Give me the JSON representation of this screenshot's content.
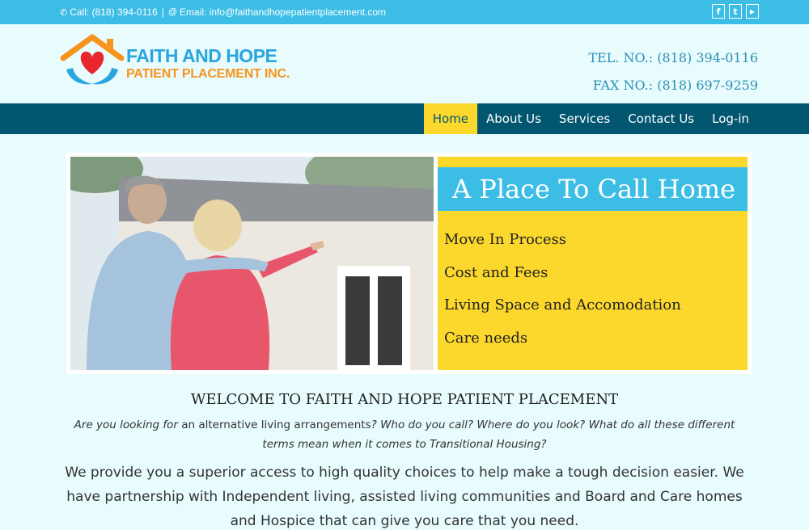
{
  "topbar": {
    "call_label": "Call: (818) 394-0116",
    "separator": "|",
    "email_label": "Email: info@faithandhopepatientplacement.com",
    "social": [
      {
        "icon": "facebook-icon",
        "glyph": "f"
      },
      {
        "icon": "twitter-icon",
        "glyph": "t"
      },
      {
        "icon": "youtube-icon",
        "glyph": "▶"
      }
    ]
  },
  "header": {
    "logo_line1": "FAITH AND HOPE",
    "logo_line2": "PATIENT PLACEMENT INC.",
    "tel": "TEL. NO.: (818) 394-0116",
    "fax": "FAX NO.: (818) 697-9259"
  },
  "nav": {
    "items": [
      "Home",
      "About Us",
      "Services",
      "Contact Us",
      "Log-in"
    ],
    "active": "Home"
  },
  "hero": {
    "title": "A Place To Call Home",
    "links": [
      "Move In Process",
      "Cost and Fees",
      "Living Space and Accomodation",
      "Care needs"
    ]
  },
  "welcome": {
    "heading": "WELCOME TO FAITH AND HOPE PATIENT PLACEMENT",
    "intro_italic1": "Are you looking for",
    "intro_plain": " an alternative living arrangements",
    "intro_italic2": "? Who do you call? Where do you look? What do all these different terms mean when it comes to Transitional Housing?",
    "body": "We provide you a superior access to high quality choices to help make a tough decision easier. We have partnership with Independent living, assisted living communities and Board and Care homes and Hospice that can give you care that you need."
  },
  "colors": {
    "topbar": "#3cbde6",
    "nav": "#035670",
    "accent_yellow": "#fcd82d",
    "background": "#e8fbfd",
    "phone_text": "#2b8fb6"
  }
}
